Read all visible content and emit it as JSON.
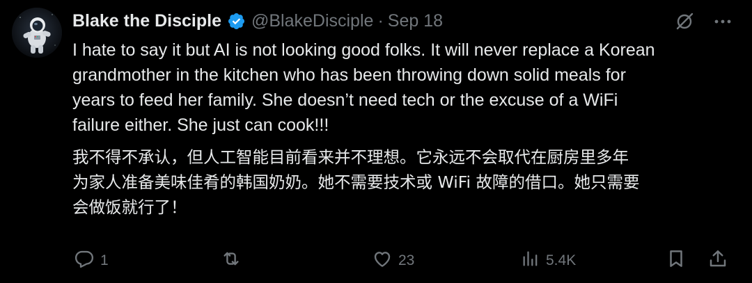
{
  "author": {
    "name": "Blake the Disciple",
    "handle": "@BlakeDisciple",
    "separator": "·",
    "timestamp": "Sep 18",
    "verified": true,
    "verified_color": "#1d9bf0"
  },
  "tweet": {
    "text_en": "I hate to say it but AI is not looking good folks. It will never replace a Korean\ngrandmother in the kitchen who has been throwing down solid meals for\nyears to feed her family. She doesn’t need tech or the excuse of a WiFi\nfailure either. She just can cook!!!",
    "text_zh": "我不得不承认，但人工智能目前看来并不理想。它永远不会取代在厨房里多年\n为家人准备美味佳肴的韩国奶奶。她不需要技术或 WiFi 故障的借口。她只需要\n会做饭就行了！"
  },
  "actions": {
    "replies": "1",
    "retweets": "",
    "likes": "23",
    "views": "5.4K"
  },
  "icons": {
    "mute": "grok-slash-icon",
    "more": "more-icon",
    "reply": "reply-icon",
    "retweet": "retweet-icon",
    "like": "heart-icon",
    "views": "views-icon",
    "bookmark": "bookmark-icon",
    "share": "share-icon"
  },
  "colors": {
    "background": "#000000",
    "text": "#e7e9ea",
    "muted": "#71767b"
  }
}
